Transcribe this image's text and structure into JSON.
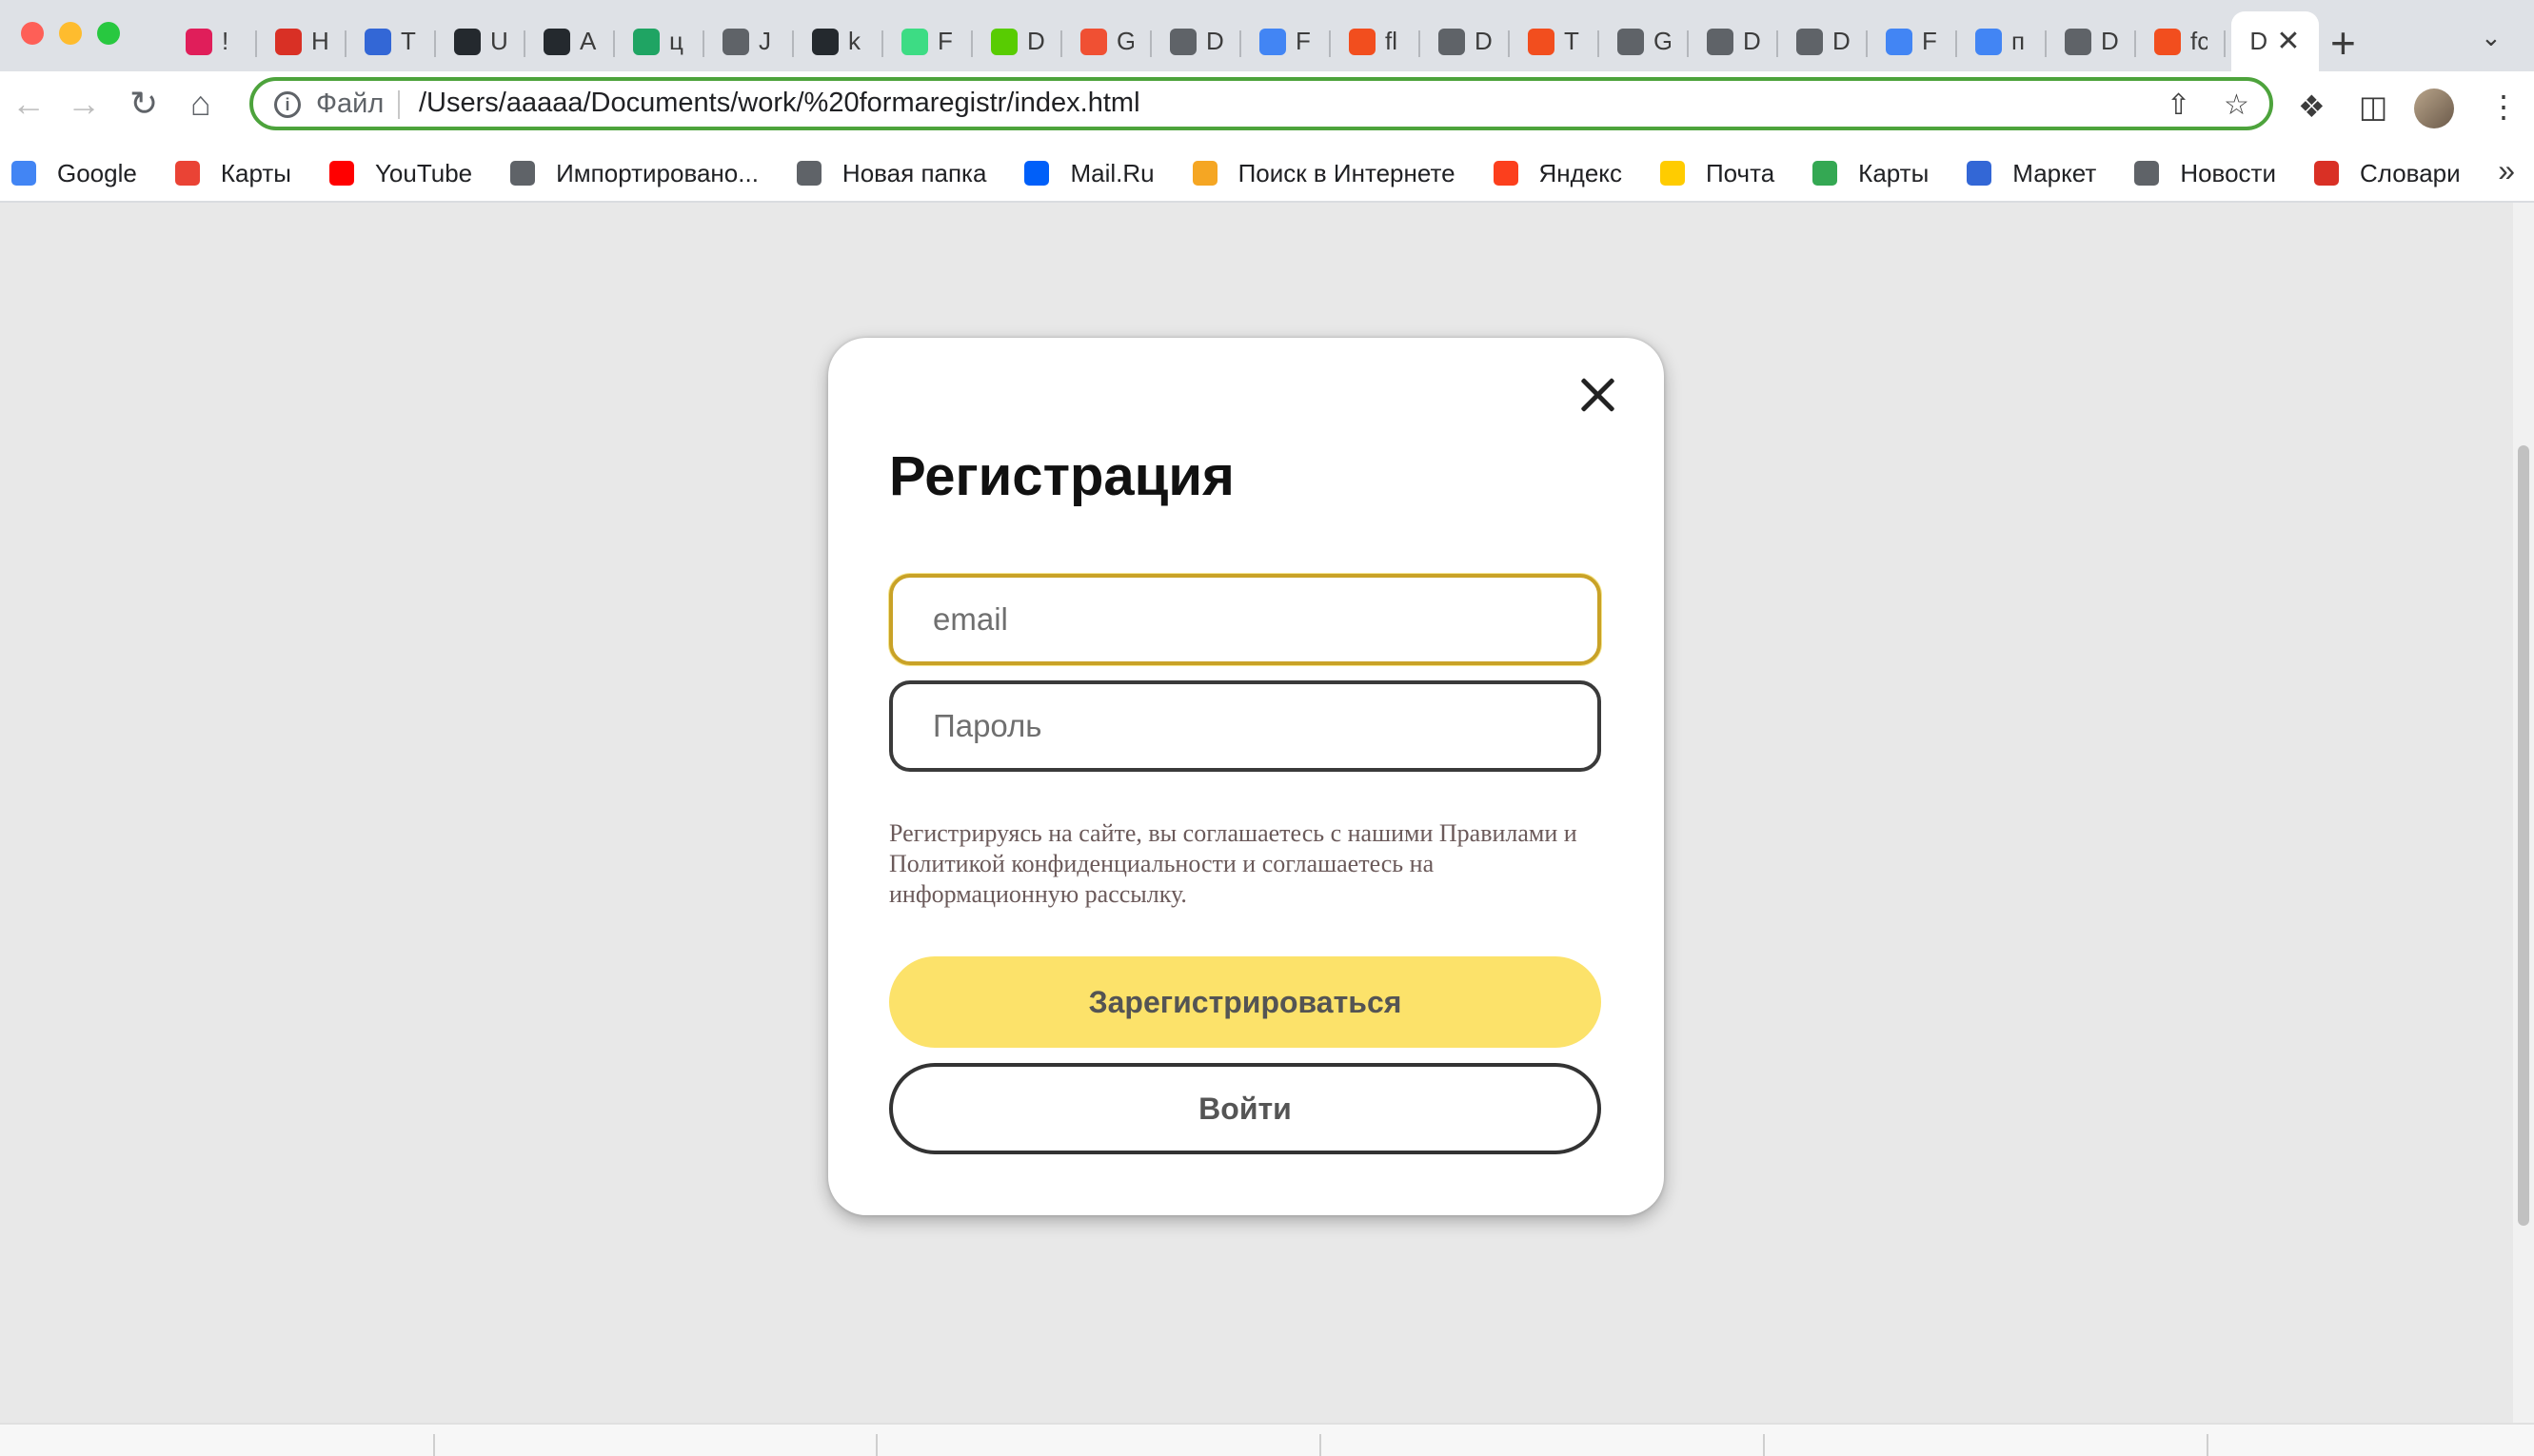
{
  "browser": {
    "tabs": [
      {
        "label": "!",
        "icon": "slack-icon",
        "color": "#e01e5a"
      },
      {
        "label": "H",
        "icon": "pin-icon",
        "color": "#d93025"
      },
      {
        "label": "T",
        "icon": "wheel-icon",
        "color": "#3367d6"
      },
      {
        "label": "U",
        "icon": "github-icon",
        "color": "#24292e"
      },
      {
        "label": "A",
        "icon": "github-icon",
        "color": "#24292e"
      },
      {
        "label": "ц",
        "icon": "drive-icon",
        "color": "#1fa463"
      },
      {
        "label": "J",
        "icon": "globe-icon",
        "color": "#5f6368"
      },
      {
        "label": "k",
        "icon": "github-icon",
        "color": "#24292e"
      },
      {
        "label": "F",
        "icon": "android-icon",
        "color": "#3ddc84"
      },
      {
        "label": "D",
        "icon": "owl-icon",
        "color": "#58cc02"
      },
      {
        "label": "G",
        "icon": "git-icon",
        "color": "#f05033"
      },
      {
        "label": "D",
        "icon": "globe-icon",
        "color": "#5f6368"
      },
      {
        "label": "F",
        "icon": "docs-icon",
        "color": "#4285f4"
      },
      {
        "label": "fl",
        "icon": "figma-icon",
        "color": "#f24e1e"
      },
      {
        "label": "D",
        "icon": "globe-icon",
        "color": "#5f6368"
      },
      {
        "label": "T",
        "icon": "figma-icon",
        "color": "#f24e1e"
      },
      {
        "label": "G",
        "icon": "globe-icon",
        "color": "#5f6368"
      },
      {
        "label": "D",
        "icon": "globe-icon",
        "color": "#5f6368"
      },
      {
        "label": "D",
        "icon": "globe-icon",
        "color": "#5f6368"
      },
      {
        "label": "F",
        "icon": "docs-icon",
        "color": "#4285f4"
      },
      {
        "label": "п",
        "icon": "google-icon",
        "color": "#4285f4"
      },
      {
        "label": "D",
        "icon": "globe-icon",
        "color": "#5f6368"
      },
      {
        "label": "fc",
        "icon": "figma-icon",
        "color": "#f24e1e"
      }
    ],
    "active_tab": {
      "label": "D"
    },
    "address": {
      "scheme": "Файл",
      "url": "/Users/aaaaa/Documents/work/%20formaregistr/index.html"
    },
    "bookmarks": [
      {
        "label": "Google",
        "icon": "google-icon",
        "color": "#4285f4"
      },
      {
        "label": "Карты",
        "icon": "map-pin-icon",
        "color": "#ea4335"
      },
      {
        "label": "YouTube",
        "icon": "youtube-icon",
        "color": "#ff0000"
      },
      {
        "label": "Импортировано...",
        "icon": "folder-icon",
        "color": "#5f6368"
      },
      {
        "label": "Новая папка",
        "icon": "folder-icon",
        "color": "#5f6368"
      },
      {
        "label": "Mail.Ru",
        "icon": "mailru-icon",
        "color": "#005ff9"
      },
      {
        "label": "Поиск в Интернете",
        "icon": "search-icon",
        "color": "#f5a623"
      },
      {
        "label": "Яндекс",
        "icon": "yandex-icon",
        "color": "#fc3f1d"
      },
      {
        "label": "Почта",
        "icon": "mail-icon",
        "color": "#ffcc00"
      },
      {
        "label": "Карты",
        "icon": "maps-icon",
        "color": "#34a853"
      },
      {
        "label": "Маркет",
        "icon": "market-icon",
        "color": "#3367d6"
      },
      {
        "label": "Новости",
        "icon": "news-icon",
        "color": "#5f6368"
      },
      {
        "label": "Словари",
        "icon": "dictionary-icon",
        "color": "#d93025"
      }
    ]
  },
  "modal": {
    "title": "Регистрация",
    "email_placeholder": "email",
    "password_placeholder": "Пароль",
    "terms": "Регистрируясь на сайте, вы соглашаетесь с нашими Правилами и Политикой конфиденциальности и соглашаетесь на информационную рассылку.",
    "register_button": "Зарегистрироваться",
    "login_button": "Войти",
    "accent_color": "#fce26a"
  }
}
